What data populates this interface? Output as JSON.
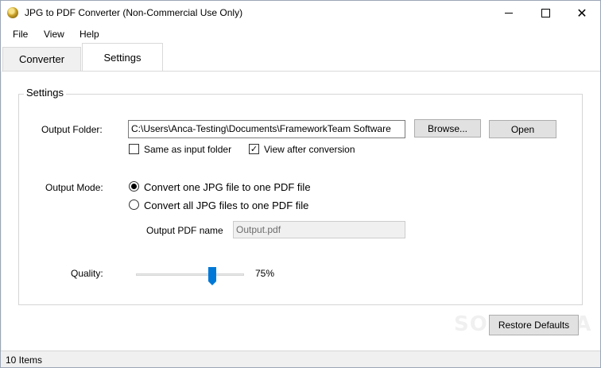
{
  "window": {
    "title": "JPG to PDF Converter (Non-Commercial Use Only)",
    "icon": "app-disc-icon",
    "controls": [
      "minimize-icon",
      "maximize-icon",
      "close-icon"
    ],
    "close_glyph": "✕"
  },
  "menu": {
    "items": [
      "File",
      "View",
      "Help"
    ]
  },
  "tabs": [
    {
      "label": "Converter",
      "selected": false
    },
    {
      "label": "Settings",
      "selected": true
    }
  ],
  "settings": {
    "group_title": "Settings",
    "output_folder": {
      "label": "Output Folder:",
      "value": "C:\\Users\\Anca-Testing\\Documents\\FrameworkTeam Software",
      "browse_label": "Browse...",
      "open_label": "Open"
    },
    "checkboxes": {
      "same_as_input": {
        "label": "Same as input folder",
        "checked": false
      },
      "view_after": {
        "label": "View after conversion",
        "checked": true,
        "glyph": "✓"
      }
    },
    "output_mode": {
      "label": "Output Mode:",
      "options": [
        {
          "label": "Convert one JPG file to one PDF file",
          "selected": true
        },
        {
          "label": "Convert all JPG files to one PDF file",
          "selected": false
        }
      ],
      "pdf_name_label": "Output PDF name",
      "pdf_name_placeholder": "Output.pdf"
    },
    "quality": {
      "label": "Quality:",
      "value_text": "75%",
      "value": 0.75
    },
    "restore_defaults_label": "Restore Defaults"
  },
  "watermark": "SOFTPEDIA",
  "status": {
    "text": "10 Items"
  },
  "colors": {
    "accent": "#0078d7",
    "window_bg": "#f0f0f0",
    "content_bg": "#ffffff"
  }
}
